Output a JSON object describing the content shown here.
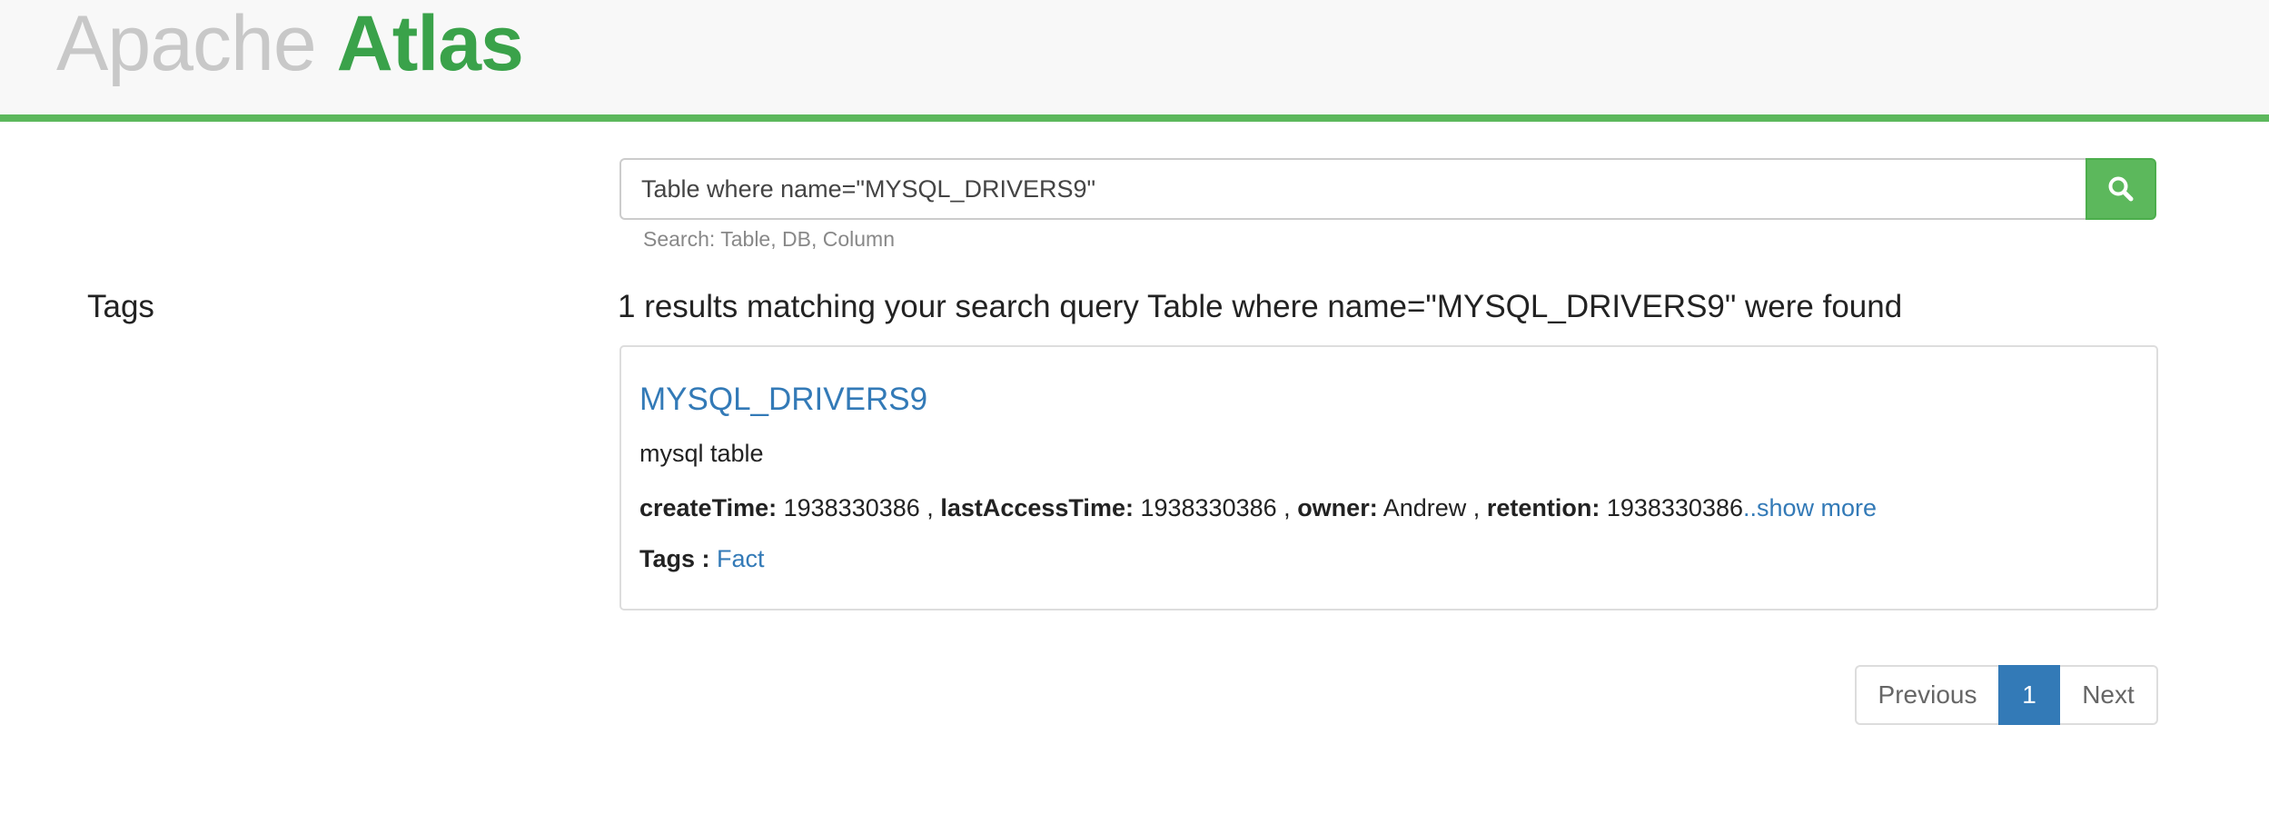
{
  "header": {
    "logo_apache": "Apache",
    "logo_atlas": "Atlas",
    "accent_color": "#5cb85c"
  },
  "search": {
    "value": "Table where name=\"MYSQL_DRIVERS9\"",
    "hint": "Search: Table, DB, Column",
    "button_icon": "search-icon"
  },
  "sidebar": {
    "tags_heading": "Tags"
  },
  "results": {
    "summary": "1 results matching your search query Table where name=\"MYSQL_DRIVERS9\" were found",
    "items": [
      {
        "name": "MYSQL_DRIVERS9",
        "description": "mysql table",
        "attributes": [
          {
            "key": "createTime:",
            "value": "1938330386",
            "sep": ","
          },
          {
            "key": "lastAccessTime:",
            "value": "1938330386",
            "sep": ","
          },
          {
            "key": "owner:",
            "value": "Andrew",
            "sep": ","
          },
          {
            "key": "retention:",
            "value": "1938330386",
            "sep": ""
          }
        ],
        "show_more": "..show more",
        "tags_label": "Tags :",
        "tags": [
          "Fact"
        ]
      }
    ]
  },
  "pagination": {
    "previous": "Previous",
    "current": "1",
    "next": "Next"
  }
}
